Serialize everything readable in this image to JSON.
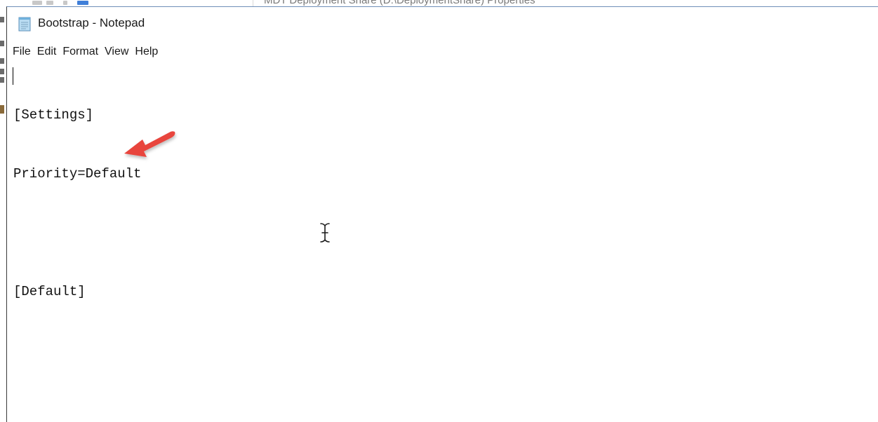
{
  "window": {
    "title": "Bootstrap - Notepad",
    "app_icon": "notepad-icon"
  },
  "menu": {
    "items": [
      "File",
      "Edit",
      "Format",
      "View",
      "Help"
    ]
  },
  "editor": {
    "lines": [
      "[Settings]",
      "Priority=Default",
      "",
      "[Default]"
    ]
  },
  "annotation": {
    "arrow_icon": "red-arrow-icon",
    "arrow_color": "#e8453c"
  },
  "cursor": {
    "icon": "ibeam-cursor-icon"
  },
  "background_window": {
    "title": "MDT Deployment Share (D:\\DeploymentShare) Properties"
  }
}
